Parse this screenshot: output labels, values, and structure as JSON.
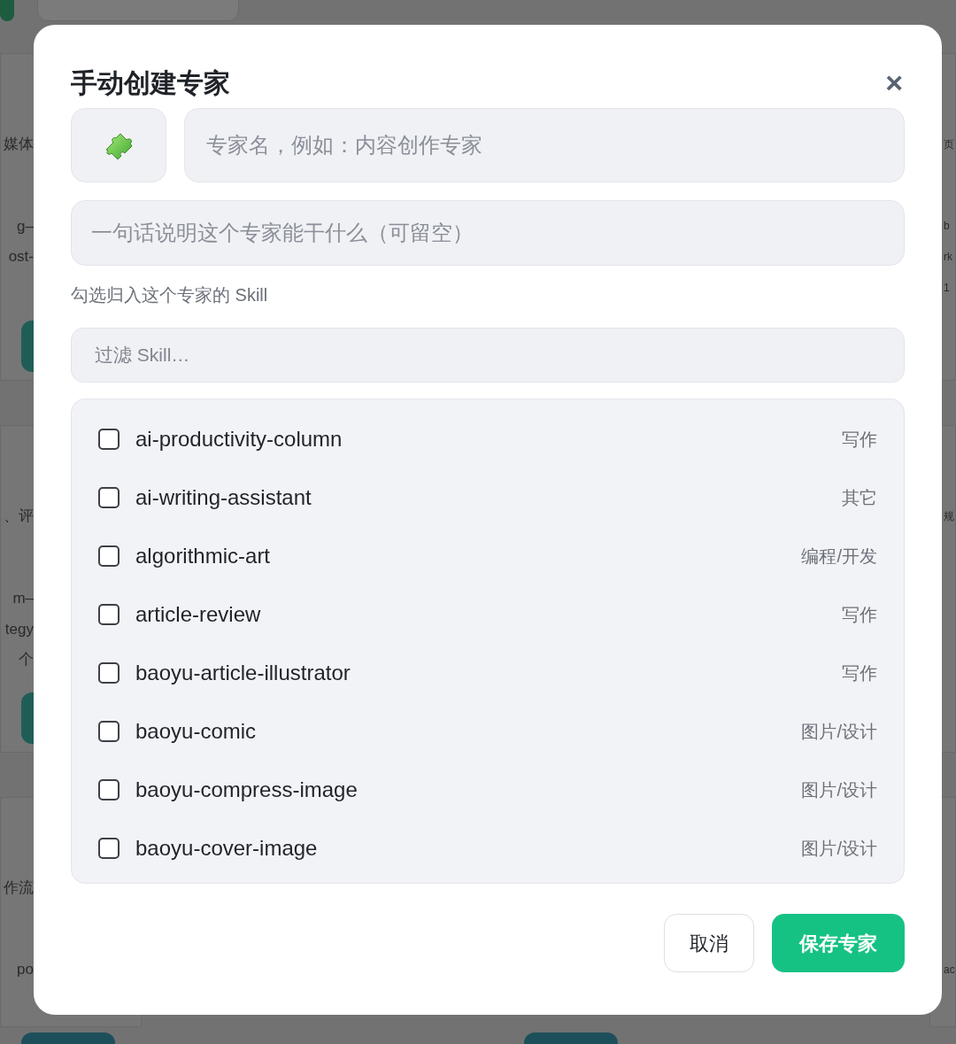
{
  "background": {
    "left_fragments": [
      "媒体",
      "g–",
      "ost-",
      "、评",
      "m–",
      "tegy",
      "个",
      "作流",
      "po"
    ],
    "right_fragments": [
      "页",
      "b",
      "rk",
      "1",
      "规",
      "ac"
    ]
  },
  "dialog": {
    "title": "手动创建专家",
    "close": "×",
    "name_field": {
      "placeholder": "专家名，例如：内容创作专家"
    },
    "description_field": {
      "placeholder": "一句话说明这个专家能干什么（可留空）"
    },
    "skills_label": "勾选归入这个专家的 Skill",
    "filter_field": {
      "placeholder": "过滤 Skill…"
    },
    "skills": [
      {
        "name": "ai-productivity-column",
        "category": "写作",
        "checked": false
      },
      {
        "name": "ai-writing-assistant",
        "category": "其它",
        "checked": false
      },
      {
        "name": "algorithmic-art",
        "category": "编程/开发",
        "checked": false
      },
      {
        "name": "article-review",
        "category": "写作",
        "checked": false
      },
      {
        "name": "baoyu-article-illustrator",
        "category": "写作",
        "checked": false
      },
      {
        "name": "baoyu-comic",
        "category": "图片/设计",
        "checked": false
      },
      {
        "name": "baoyu-compress-image",
        "category": "图片/设计",
        "checked": false
      },
      {
        "name": "baoyu-cover-image",
        "category": "图片/设计",
        "checked": false
      }
    ],
    "buttons": {
      "cancel": "取消",
      "save": "保存专家"
    }
  }
}
